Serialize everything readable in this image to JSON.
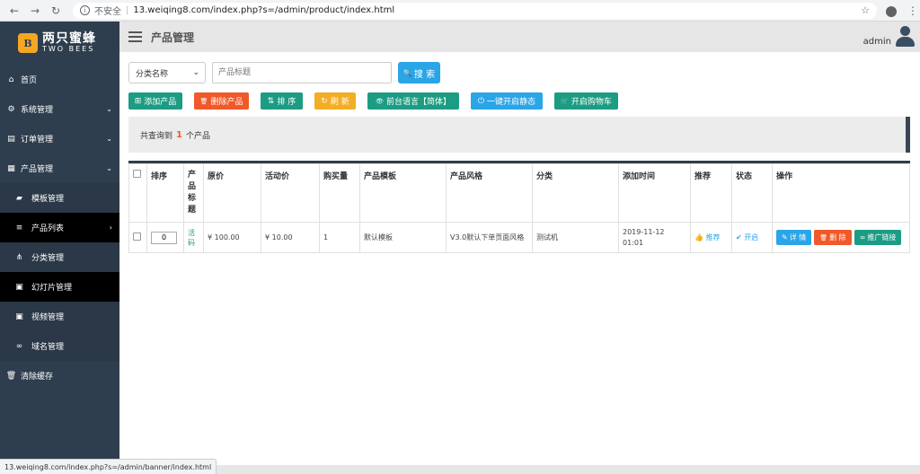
{
  "browser": {
    "back": "←",
    "forward": "→",
    "reload": "↻",
    "info_icon": "i",
    "insecure_label": "不安全",
    "separator": "|",
    "url": "13.weiqing8.com/index.php?s=/admin/product/index.html",
    "star": "☆",
    "menu": "⋮"
  },
  "sidebar": {
    "logo": {
      "mark": "B",
      "cn": "两只蜜蜂",
      "en": "TWO BEES"
    },
    "items": [
      {
        "label": "首页",
        "icon": "home-icon",
        "glyph": "⌂"
      },
      {
        "label": "系统管理",
        "icon": "gear-icon",
        "glyph": "⚙",
        "chevron": "⌄"
      },
      {
        "label": "订单管理",
        "icon": "list-icon",
        "glyph": "▤",
        "chevron": "⌄"
      },
      {
        "label": "产品管理",
        "icon": "grid-icon",
        "glyph": "▦",
        "chevron": "⌄"
      },
      {
        "label": "模板管理",
        "icon": "folder-icon",
        "glyph": "▰"
      },
      {
        "label": "产品列表",
        "icon": "menu-icon",
        "glyph": "≡",
        "chevron": "›"
      },
      {
        "label": "分类管理",
        "icon": "sitemap-icon",
        "glyph": "⋔"
      },
      {
        "label": "幻灯片管理",
        "icon": "image-icon",
        "glyph": "▣"
      },
      {
        "label": "视频管理",
        "icon": "video-icon",
        "glyph": "▣"
      },
      {
        "label": "域名管理",
        "icon": "link-icon",
        "glyph": "∞"
      },
      {
        "label": "清除缓存",
        "icon": "trash-icon",
        "glyph": "🗑"
      }
    ]
  },
  "header": {
    "title": "产品管理",
    "user": "admin"
  },
  "search": {
    "category_select": "分类名称",
    "title_placeholder": "产品标题",
    "search_label": "搜 索",
    "search_glyph": "🔍"
  },
  "actions": [
    {
      "label": "添加产品",
      "glyph": "⊞",
      "color": "#1c9c83"
    },
    {
      "label": "删除产品",
      "glyph": "🗑",
      "color": "#f0592a"
    },
    {
      "label": "排 序",
      "glyph": "⇅",
      "color": "#1c9c83"
    },
    {
      "label": "刷 新",
      "glyph": "↻",
      "color": "#f3ae25"
    },
    {
      "label": "前台语言【简体】",
      "glyph": "👁",
      "color": "#1c9c83"
    },
    {
      "label": "一键开启静态",
      "glyph": "⏻",
      "color": "#2aa5e8"
    },
    {
      "label": "开启购物车",
      "glyph": "🛒",
      "color": "#1c9c83"
    }
  ],
  "summary": {
    "prefix": "共查询到",
    "count": "1",
    "suffix": "个产品"
  },
  "table": {
    "headers": [
      "排序",
      "产品标题",
      "原价",
      "活动价",
      "购买量",
      "产品模板",
      "产品风格",
      "分类",
      "添加时间",
      "推荐",
      "状态",
      "操作"
    ],
    "rows": [
      {
        "sort": "0",
        "title": "活码",
        "price": "¥ 100.00",
        "sale_price": "¥ 10.00",
        "purchases": "1",
        "template": "默认模板",
        "style": "V3.0默认下单页面风格",
        "category": "测试机",
        "added_date": "2019-11-12",
        "added_time": "01:01",
        "recommend": "推荐",
        "status": "开启",
        "ops": {
          "detail": "详 情",
          "delete": "删 除",
          "promo": "推广链接"
        }
      }
    ]
  },
  "statusbar": {
    "url": "13.weiqing8.com/index.php?s=/admin/banner/index.html"
  }
}
